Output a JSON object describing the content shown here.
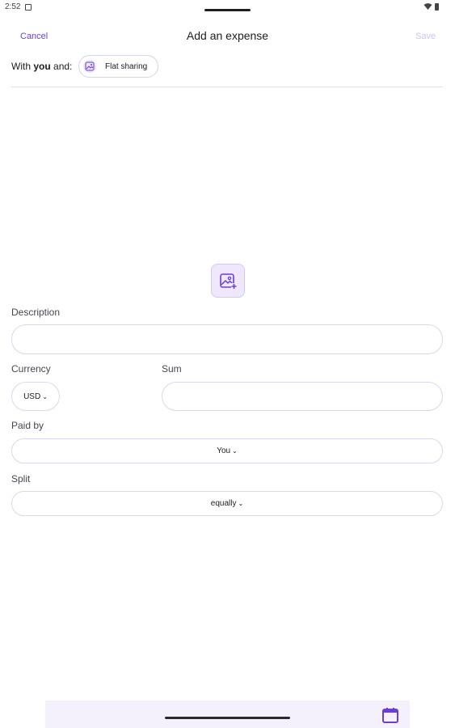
{
  "status_bar": {
    "time": "2:52"
  },
  "app_bar": {
    "cancel_label": "Cancel",
    "title": "Add an expense",
    "save_label": "Save"
  },
  "participants": {
    "prefix": "With ",
    "bold": "you",
    "suffix": " and:",
    "group_name": "Flat sharing"
  },
  "form": {
    "description_label": "Description",
    "description_value": "",
    "currency_label": "Currency",
    "currency_value": "USD",
    "sum_label": "Sum",
    "sum_value": "",
    "paid_by_label": "Paid by",
    "paid_by_value": "You",
    "split_label": "Split",
    "split_value": "equally"
  },
  "icons": {
    "add_image": "add-photo-icon",
    "calendar": "calendar-icon",
    "group": "group-image-icon"
  },
  "colors": {
    "accent": "#6b3fd1",
    "save_disabled": "#cfc4ef",
    "input_border": "#ddd6f1",
    "bottom_bar": "#f5f1fc"
  }
}
